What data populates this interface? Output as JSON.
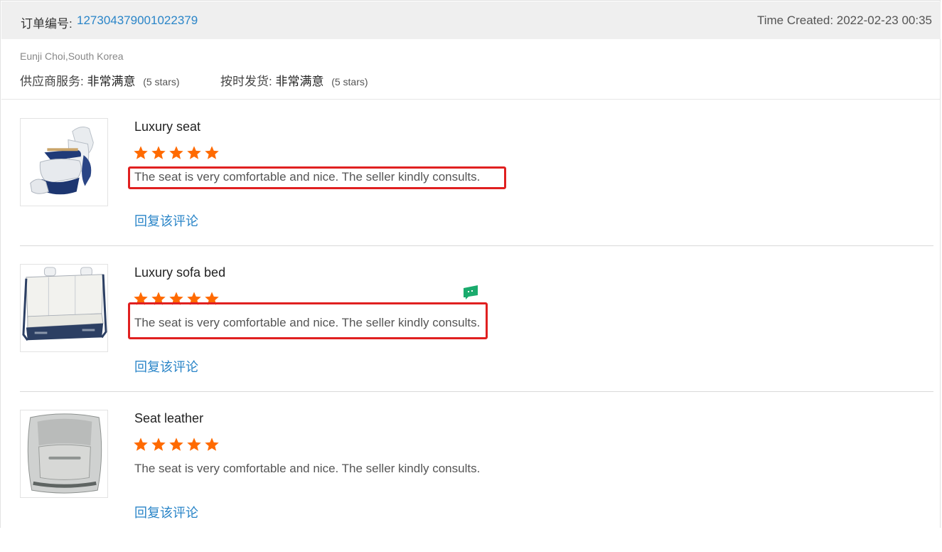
{
  "header": {
    "order_label": "订单编号:",
    "order_number": "127304379001022379",
    "time_created": "Time Created: 2022-02-23 00:35"
  },
  "buyer": {
    "name_country": "Eunji Choi,South Korea",
    "supplier_service_label": "供应商服务:",
    "supplier_service_value": "非常满意",
    "supplier_service_stars": "(5 stars)",
    "on_time_label": "按时发货:",
    "on_time_value": "非常满意",
    "on_time_stars": "(5 stars)"
  },
  "colors": {
    "accent_link": "#2a85c8",
    "star": "#ff6a00",
    "highlight_border": "#e02020"
  },
  "reviews": [
    {
      "title": "Luxury seat",
      "rating": 5,
      "comment": "The seat is very comfortable and nice. The seller kindly consults.",
      "reply_label": "回复该评论",
      "image_icon": "luxury-seat-image"
    },
    {
      "title": "Luxury sofa bed",
      "rating": 5,
      "comment": "The seat is very comfortable and nice. The seller kindly consults.",
      "reply_label": "回复该评论",
      "image_icon": "sofa-bed-image"
    },
    {
      "title": "Seat leather",
      "rating": 5,
      "comment": "The seat is very comfortable and nice. The seller kindly consults.",
      "reply_label": "回复该评论",
      "image_icon": "seat-leather-image"
    }
  ]
}
